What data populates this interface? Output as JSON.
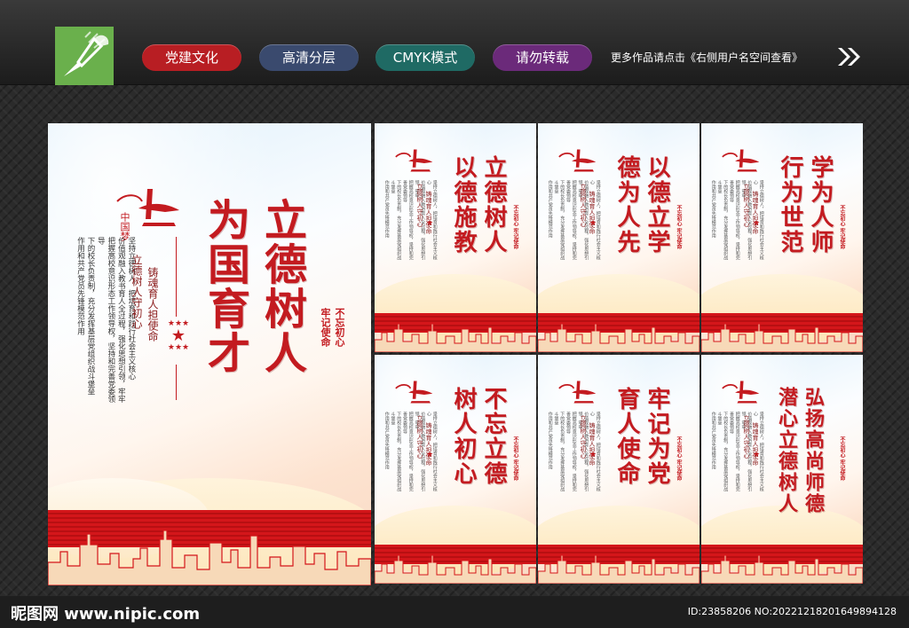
{
  "tags": [
    "党建文化",
    "高清分层",
    "CMYK模式",
    "请勿转载"
  ],
  "more_text": "更多作品请点击《右侧用户名空间查看》",
  "logo_script": "中国梦",
  "main_poster": {
    "title_1": "立德树人",
    "title_2": "为国育才",
    "slogan_1": "不忘初心",
    "slogan_2": "牢记使命",
    "sub_1": "立德树人守初心",
    "sub_2": "铸魂育人担使命",
    "body": [
      "坚持立德树人，把培育和践行社会主义核心",
      "价值观融入教书育人全过程，强化思想引领，牢牢",
      "把握高校意识形态工作领导权，坚持和完善党委领导",
      "下的校长负责制，充分发挥基层党组织战斗堡垒",
      "作用和共产党员先锋模范作用"
    ],
    "stars": "★★★"
  },
  "small_posters": [
    {
      "title_1": "立德树人",
      "title_2": "以德施教"
    },
    {
      "title_1": "以德立学",
      "title_2": "德为人先"
    },
    {
      "title_1": "学为人师",
      "title_2": "行为世范"
    },
    {
      "title_1": "不忘立德",
      "title_2": "树人初心"
    },
    {
      "title_1": "牢记为党",
      "title_2": "育人使命"
    },
    {
      "title_1": "弘扬高尚师德",
      "title_2": "潜心立德树人"
    }
  ],
  "small_sub_1": "立德树人守初心",
  "small_sub_2": "铸魂育人担使命",
  "small_slogan": "不忘初心  牢记使命",
  "footer": {
    "brand": "昵图网 www.nipic.com",
    "id": "ID:23858206 NO:20221218201649894128"
  },
  "colors": {
    "accent_red": "#c31b20",
    "band_red": "#d4161a",
    "logo_green": "#6ab04c"
  }
}
